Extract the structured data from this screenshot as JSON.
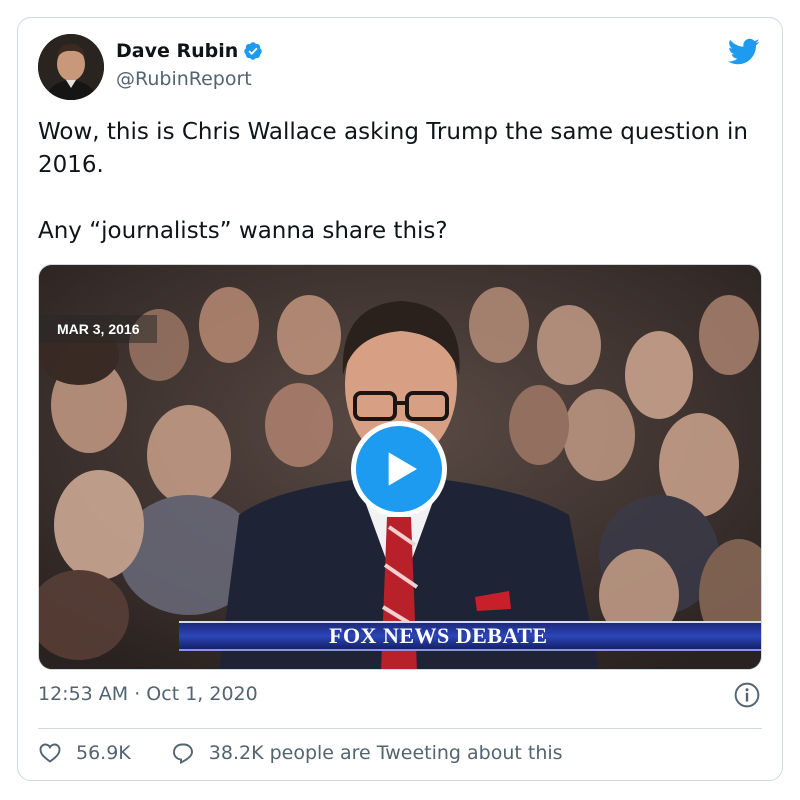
{
  "author": {
    "display_name": "Dave Rubin",
    "handle": "@RubinReport",
    "verified": true,
    "avatar_icon": "avatar-photo"
  },
  "brand": {
    "icon": "twitter-bird-icon",
    "color": "#1d9bf0"
  },
  "tweet": {
    "text": "Wow, this is Chris Wallace asking Trump the same question in 2016.\n\nAny “journalists” wanna share this?"
  },
  "media": {
    "date_overlay": "MAR 3, 2016",
    "banner_text": "FOX NEWS DEBATE",
    "play_icon": "play-icon"
  },
  "meta": {
    "timestamp": "12:53 AM · Oct 1, 2020",
    "info_icon": "info-icon"
  },
  "actions": {
    "like_count": "56.9K",
    "reply_text": "38.2K people are Tweeting about this"
  },
  "colors": {
    "text_primary": "#0f1419",
    "text_secondary": "#536471",
    "border": "#cfd9de",
    "accent": "#1d9bf0"
  }
}
